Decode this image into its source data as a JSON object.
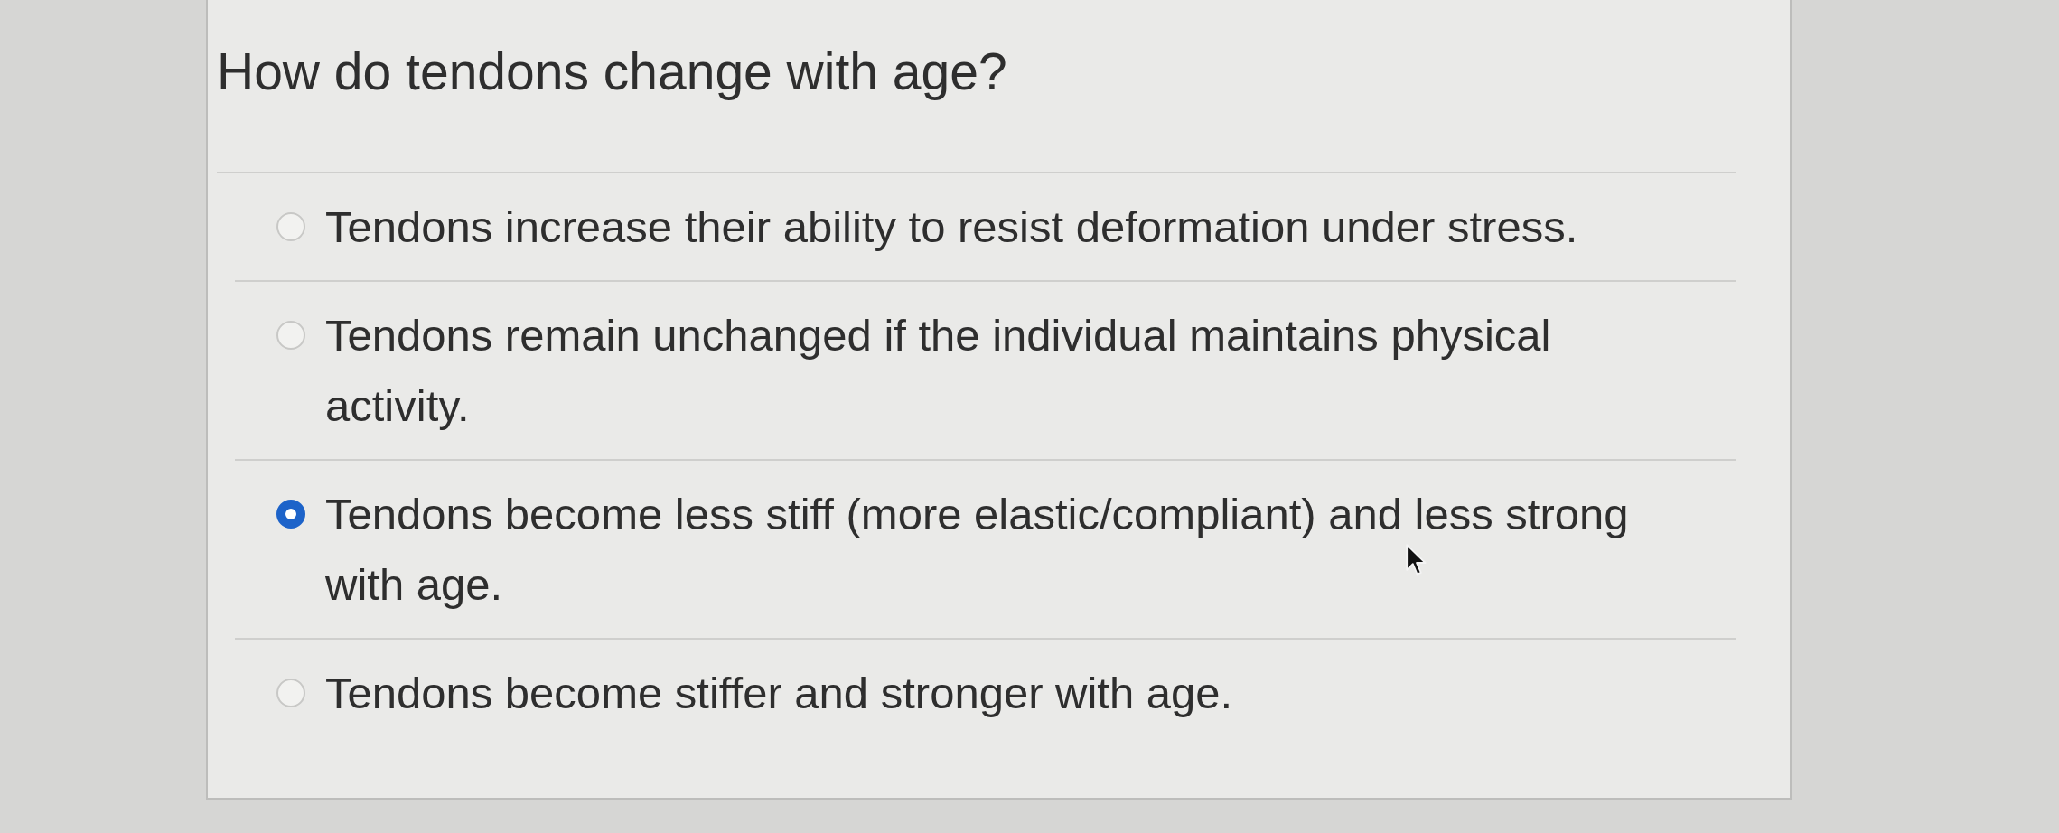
{
  "question": {
    "text": "How do tendons change with age?"
  },
  "options": [
    {
      "label": "Tendons increase their ability to resist deformation under stress.",
      "selected": false
    },
    {
      "label": "Tendons remain unchanged if the individual maintains physical activity.",
      "selected": false
    },
    {
      "label": "Tendons become less stiff (more elastic/compliant) and less strong with age.",
      "selected": true
    },
    {
      "label": "Tendons become stiffer and stronger with age.",
      "selected": false
    }
  ]
}
